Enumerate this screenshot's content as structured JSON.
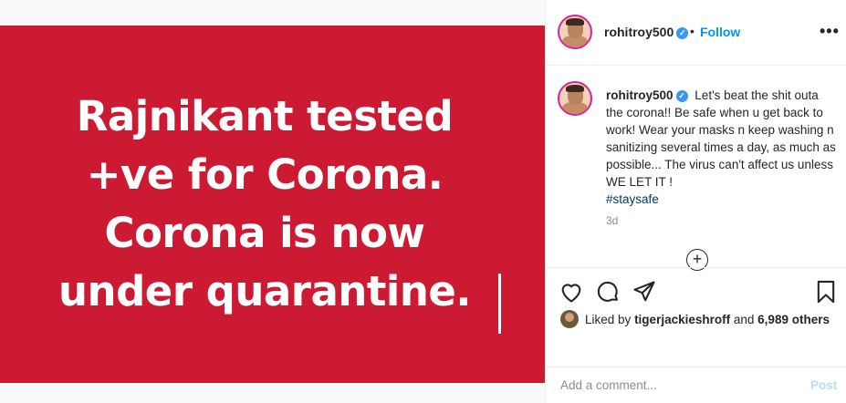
{
  "media": {
    "background": "#cc1a33",
    "lines": [
      "Rajnikant tested",
      "+ve for Corona.",
      "Corona is now",
      "under quarantine."
    ]
  },
  "header": {
    "username": "rohitroy500",
    "separator": "•",
    "follow_label": "Follow",
    "more_label": "•••"
  },
  "caption": {
    "username": "rohitroy500",
    "text": "Let's beat the shit outa the corona!! Be safe when u get back to work! Wear your masks n keep washing n sanitizing several times a day, as much as possible... The virus can't affect us unless WE LET IT !",
    "hashtag": "#staysafe",
    "timestamp": "3d",
    "load_more": "+"
  },
  "actions": {
    "like_icon": "heart-icon",
    "comment_icon": "comment-icon",
    "share_icon": "share-icon",
    "save_icon": "bookmark-icon"
  },
  "likes": {
    "prefix": "Liked by",
    "user": "tigerjackieshroff",
    "middle": "and",
    "others": "6,989 others"
  },
  "add_comment": {
    "placeholder": "Add a comment...",
    "post_label": "Post"
  },
  "colors": {
    "accent": "#0095f6",
    "verified": "#3897f0",
    "post_disabled": "#b2dffc"
  }
}
